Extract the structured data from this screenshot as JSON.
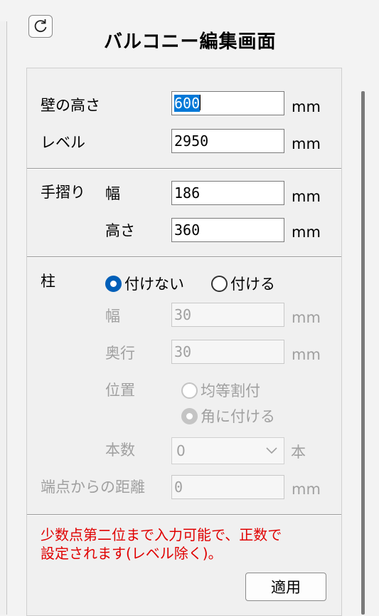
{
  "window": {
    "title": "バルコニー編集画面",
    "refresh_icon": "refresh-icon"
  },
  "wall": {
    "height_label": "壁の高さ",
    "height_value": "600",
    "height_unit": "mm",
    "level_label": "レベル",
    "level_value": "2950",
    "level_unit": "mm"
  },
  "railing": {
    "section_label": "手摺り",
    "width_label": "幅",
    "width_value": "186",
    "width_unit": "mm",
    "height_label": "高さ",
    "height_value": "360",
    "height_unit": "mm"
  },
  "pillar": {
    "section_label": "柱",
    "option_none": "付けない",
    "option_add": "付ける",
    "selected": "付けない",
    "width_label": "幅",
    "width_value": "30",
    "width_unit": "mm",
    "depth_label": "奥行",
    "depth_value": "30",
    "depth_unit": "mm",
    "position_label": "位置",
    "position_option_even": "均等割付",
    "position_option_corner": "角に付ける",
    "position_selected": "角に付ける",
    "count_label": "本数",
    "count_value": "0",
    "count_unit": "本",
    "distance_label": "端点からの距離",
    "distance_value": "0",
    "distance_unit": "mm"
  },
  "note": {
    "line1": "少数点第二位まで入力可能で、正数で",
    "line2": "設定されます(レベル除く)。"
  },
  "apply_label": "適用",
  "colors": {
    "accent": "#005fb8",
    "note": "#e00000",
    "disabled": "#a0a0a0"
  }
}
